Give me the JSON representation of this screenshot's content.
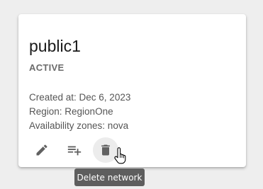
{
  "card": {
    "title": "public1",
    "status": "ACTIVE",
    "created_at": "Created at: Dec 6, 2023",
    "region": "Region: RegionOne",
    "availability_zones": "Availability zones: nova"
  },
  "actions": {
    "edit_icon": "pencil-icon",
    "add_subnet_icon": "playlist-add-icon",
    "delete_icon": "trash-icon"
  },
  "tooltip": {
    "text": "Delete network"
  },
  "colors": {
    "background": "#eeeeee",
    "card": "#ffffff",
    "icon": "#616161",
    "tooltip_bg": "#5e5e5e"
  }
}
